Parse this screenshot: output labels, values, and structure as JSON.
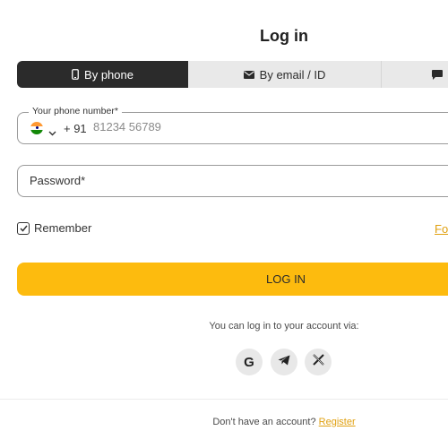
{
  "header": {
    "title": "Log in"
  },
  "tabs": [
    {
      "label": "By phone",
      "icon": "phone-icon",
      "active": true
    },
    {
      "label": "By email / ID",
      "icon": "envelope-icon",
      "active": false
    },
    {
      "label": "",
      "icon": "chat-icon",
      "active": false
    }
  ],
  "phone": {
    "label": "Your phone number*",
    "country_flag": "india-flag-icon",
    "country_code": "+ 91",
    "placeholder": "81234 56789",
    "value": ""
  },
  "password": {
    "placeholder": "Password*",
    "value": ""
  },
  "remember": {
    "label": "Remember",
    "checked": true
  },
  "forgot": {
    "label": "Fo"
  },
  "login_button": {
    "label": "LOG IN"
  },
  "social": {
    "caption": "You can log in to your account via:",
    "providers": [
      {
        "name": "google",
        "glyph": "G"
      },
      {
        "name": "telegram"
      },
      {
        "name": "x"
      }
    ]
  },
  "footer": {
    "prompt": "Don't have an account?",
    "register_label": "Register"
  },
  "colors": {
    "accent": "#fdbb0e",
    "link": "#e0a010",
    "active_tab": "#2b2b2b",
    "inactive_tab": "#e9e9e9"
  }
}
